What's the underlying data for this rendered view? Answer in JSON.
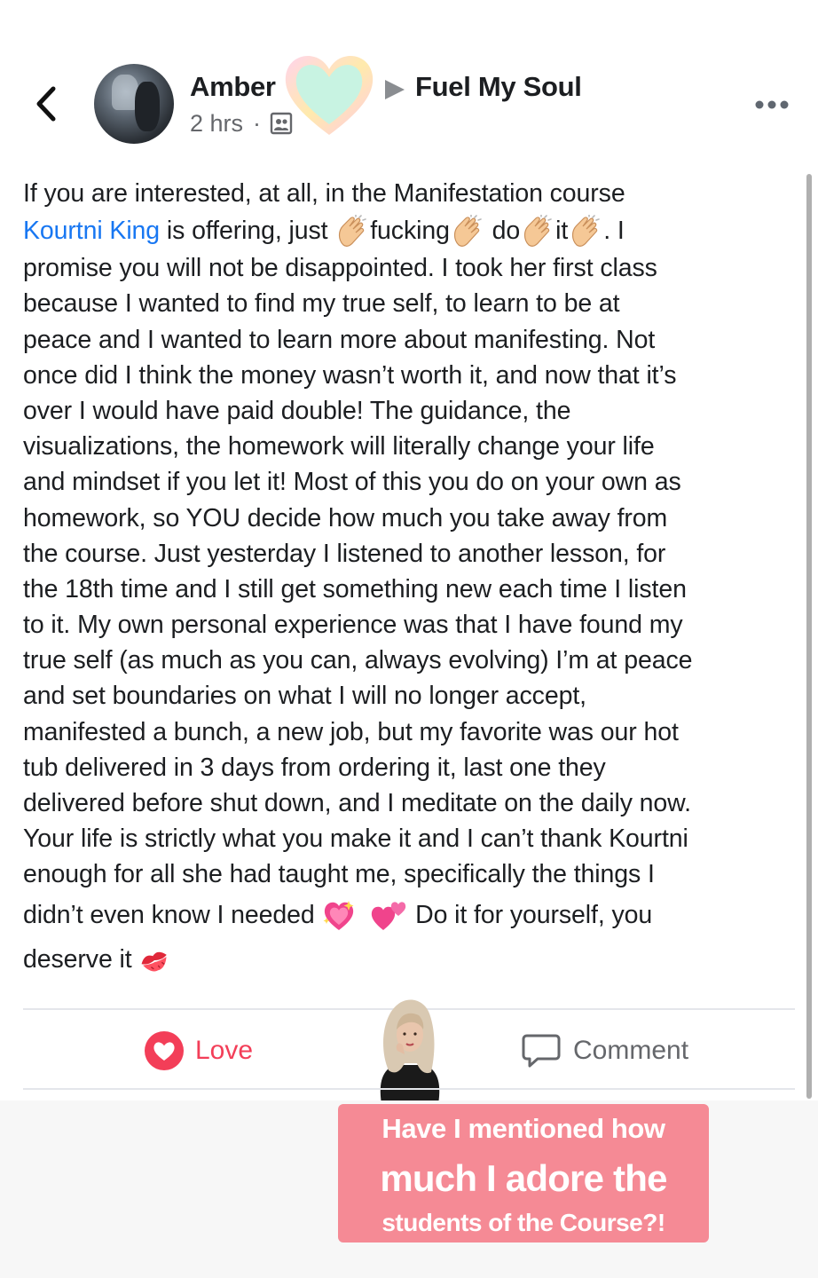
{
  "header": {
    "author": "Amber",
    "group": "Fuel My Soul",
    "timestamp": "2 hrs",
    "separator": "·",
    "icons": [
      "chevron-left-icon",
      "heart-sticker",
      "triangle-right-icon",
      "audience-icon",
      "more-icon"
    ]
  },
  "post": {
    "lines": [
      {
        "text": "If you are interested, at all,  in the Manifestation course"
      },
      {
        "mention": "Kourtni King",
        "t1": " is offering, just ",
        "w1": "fucking",
        "w2": " do",
        "w3": "it",
        "t2": ". I"
      },
      {
        "text": "promise you will not be disappointed. I took her first class"
      },
      {
        "text": "because I wanted to find my true self, to learn to be at"
      },
      {
        "text": "peace and I wanted to learn more about manifesting. Not"
      },
      {
        "text": "once did I think the money wasn’t worth it, and now that it’s"
      },
      {
        "text": "over I would have paid double! The guidance, the"
      },
      {
        "text": "visualizations, the homework will literally change your life"
      },
      {
        "text": "and mindset if you let it! Most of this you do on your own as"
      },
      {
        "text": "homework, so YOU decide how much you take away from"
      },
      {
        "text": "the course. Just yesterday I listened to another lesson, for"
      },
      {
        "text": "the 18th time and I still get something new each time I listen"
      },
      {
        "text": "to it. My own personal experience was that I have found my"
      },
      {
        "text": "true self (as much as you can, always evolving) I’m at peace"
      },
      {
        "text": "and set boundaries on what I will no longer accept,"
      },
      {
        "text": "manifested a bunch, a new job, but my favorite was our hot"
      },
      {
        "text": "tub delivered in 3 days from ordering it, last one they"
      },
      {
        "text": "delivered before shut down, and I meditate on the daily now."
      },
      {
        "text": "Your life is strictly what you make it and I can’t thank Kourtni"
      },
      {
        "text": "enough for all she had taught me, specifically the things I"
      },
      {
        "t1": "didn’t even know I needed ",
        "t2": " Do it for yourself, you"
      },
      {
        "t1": "deserve it "
      }
    ],
    "emojis": [
      "clapping-hands-icon",
      "sparkling-heart-icon",
      "two-hearts-icon",
      "kiss-mark-icon"
    ]
  },
  "actions": {
    "love_label": "Love",
    "comment_label": "Comment",
    "love_color": "#f33e58",
    "mention_color": "#1877f2"
  },
  "caption": {
    "line1": "Have I mentioned how",
    "line2": "much I adore the",
    "line3": "students of the Course?!",
    "background": "#f58a95"
  }
}
